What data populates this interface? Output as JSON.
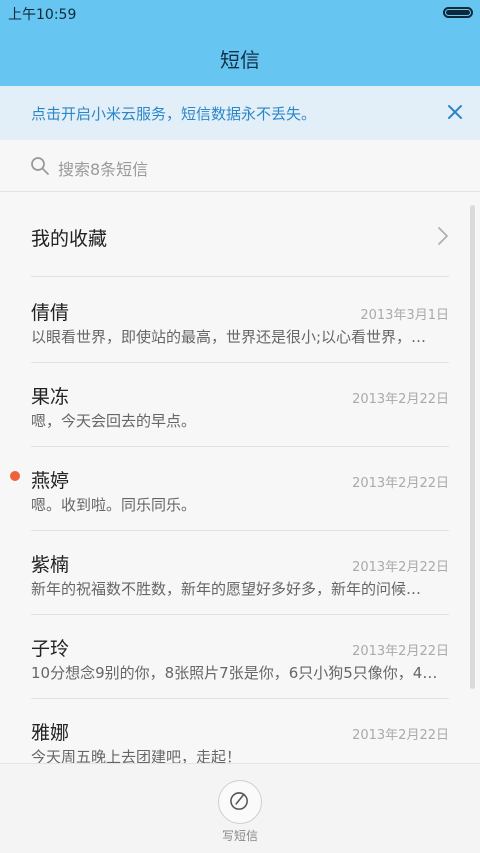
{
  "status_bar": {
    "time": "上午10:59"
  },
  "header": {
    "title": "短信"
  },
  "banner": {
    "text": "点击开启小米云服务，短信数据永不丢失。",
    "close_icon": "close-icon"
  },
  "search": {
    "placeholder": "搜索8条短信",
    "icon": "search-icon"
  },
  "favorites": {
    "label": "我的收藏",
    "icon": "chevron-right-icon"
  },
  "messages": [
    {
      "name": "倩倩",
      "date": "2013年3月1日",
      "preview": "以眼看世界，即使站的最高，世界还是很小;以心看世界，…",
      "unread": false
    },
    {
      "name": "果冻",
      "date": "2013年2月22日",
      "preview": "嗯，今天会回去的早点。",
      "unread": false
    },
    {
      "name": "燕婷",
      "date": "2013年2月22日",
      "preview": "嗯。收到啦。同乐同乐。",
      "unread": true
    },
    {
      "name": "紫楠",
      "date": "2013年2月22日",
      "preview": "新年的祝福数不胜数，新年的愿望好多好多，新年的问候…",
      "unread": false
    },
    {
      "name": "子玲",
      "date": "2013年2月22日",
      "preview": "10分想念9别的你，8张照片7张是你，6只小狗5只像你，4…",
      "unread": false
    },
    {
      "name": "雅娜",
      "date": "2013年2月22日",
      "preview": "今天周五晚上去团建吧，走起！",
      "unread": false
    }
  ],
  "compose": {
    "label": "写短信",
    "icon": "compose-icon"
  },
  "colors": {
    "header_bg": "#66c5f1",
    "banner_bg": "#e3eff8",
    "banner_text": "#2a87c8",
    "unread_dot": "#f0603a"
  }
}
